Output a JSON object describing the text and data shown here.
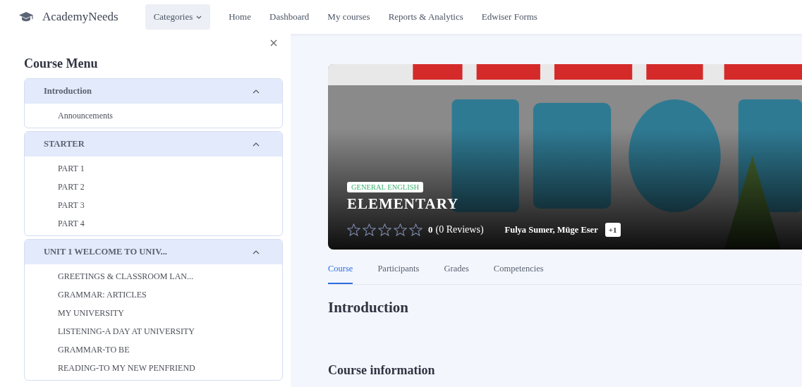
{
  "navbar": {
    "brand": "AcademyNeeds",
    "categories": "Categories",
    "links": [
      "Home",
      "Dashboard",
      "My courses",
      "Reports & Analytics",
      "Edwiser Forms"
    ]
  },
  "sidebar": {
    "title": "Course Menu",
    "sections": [
      {
        "title": "Introduction",
        "expanded": true,
        "items": [
          "Announcements"
        ]
      },
      {
        "title": "STARTER",
        "expanded": true,
        "items": [
          "PART 1",
          "PART 2",
          "PART 3",
          "PART 4"
        ]
      },
      {
        "title": "UNIT 1 WELCOME TO UNIV...",
        "expanded": true,
        "items": [
          "GREETINGS & CLASSROOM LAN...",
          "GRAMMAR: ARTICLES",
          "MY UNIVERSITY",
          "LISTENING-A DAY AT UNIVERSITY",
          "GRAMMAR-TO BE",
          "READING-TO MY NEW PENFRIEND"
        ]
      }
    ]
  },
  "banner": {
    "category": "GENERAL ENGLISH",
    "title": "ELEMENTARY",
    "stars": 0,
    "rating": "0",
    "reviews": "(0 Reviews)",
    "teachers": "Fulya Sumer, Müge Eser",
    "more_teachers": "+1"
  },
  "tabs": [
    {
      "label": "Course",
      "selected": true
    },
    {
      "label": "Participants",
      "selected": false
    },
    {
      "label": "Grades",
      "selected": false
    },
    {
      "label": "Competencies",
      "selected": false
    }
  ],
  "headings": [
    "Introduction",
    "Course information"
  ]
}
